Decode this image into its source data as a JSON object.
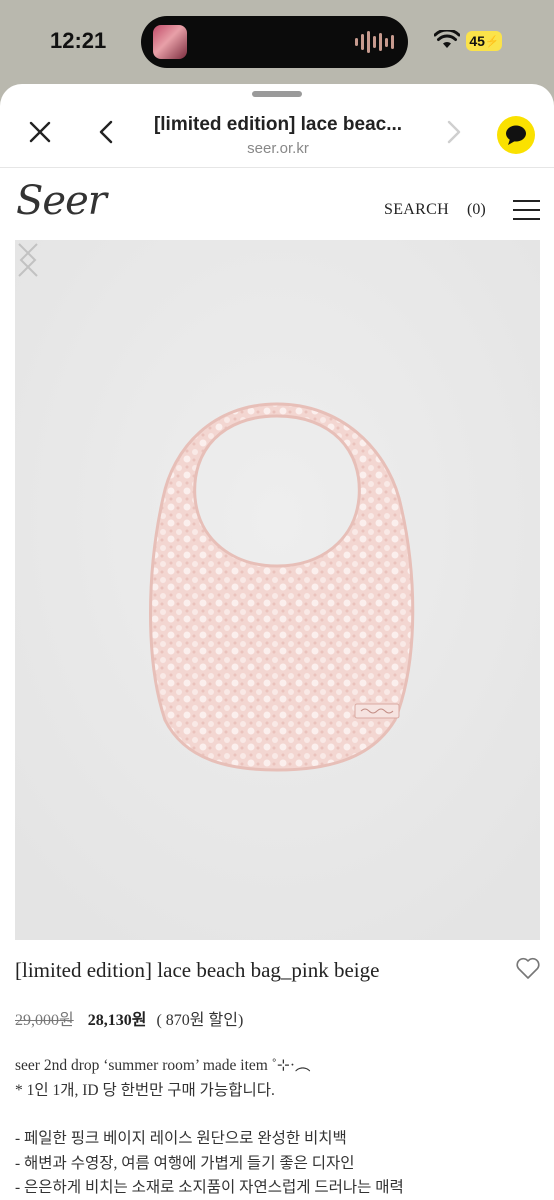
{
  "status_bar": {
    "time": "12:21",
    "battery": "45"
  },
  "browser": {
    "title": "[limited edition] lace beac...",
    "url": "seer.or.kr"
  },
  "site": {
    "logo": "Seer",
    "search": "SEARCH",
    "cart": "(0)"
  },
  "product": {
    "name": "[limited edition] lace beach bag_pink beige",
    "original_price": "29,000원",
    "sale_price": "28,130원",
    "discount": "( 870원 할인)",
    "description": [
      "seer 2nd drop ‘summer room’ made item ˚⊹·︵",
      "* 1인 1개, ID 당 한번만 구매 가능합니다.",
      "- 페일한 핑크 베이지 레이스 원단으로 완성한 비치백",
      "- 해변과 수영장, 여름 여행에 가볍게 들기 좋은 디자인",
      "- 은은하게 비치는 소재로 소지품이 자연스럽게 드러나는 매력"
    ]
  },
  "colors": {
    "status_bg": "#b9b8ae",
    "kakao_yellow": "#fae100",
    "image_bg": "#e9e9e9",
    "bag_pink": "#f2d3cf"
  }
}
